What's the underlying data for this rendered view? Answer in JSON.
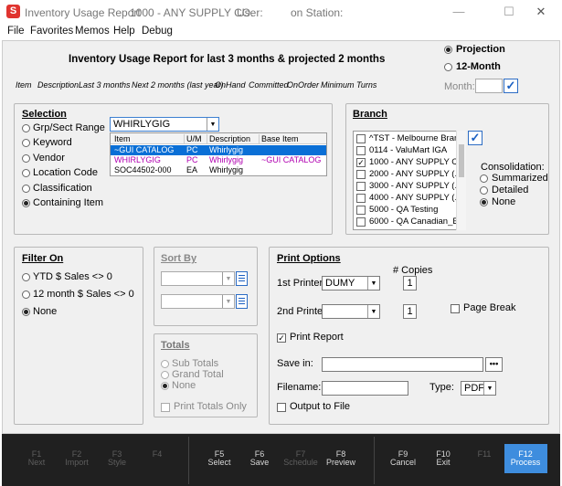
{
  "window": {
    "title": "Inventory Usage Report",
    "company": "1000 - ANY SUPPLY CO.",
    "user_label": "User:",
    "station_label": "on Station:"
  },
  "menu": [
    "File",
    "Favorites",
    "Memos",
    "Help",
    "Debug"
  ],
  "report_title": "Inventory Usage Report for last 3 months & projected 2 months",
  "columns": [
    "Item",
    "Description",
    "Last 3 months",
    "Next 2 months (last year)",
    "OnHand",
    "Committed",
    "OnOrder",
    "Minimum",
    "Turns"
  ],
  "mode": {
    "projection": "Projection",
    "twelve_month": "12-Month",
    "month_label": "Month:"
  },
  "selection": {
    "title": "Selection",
    "options": [
      "Grp/Sect Range",
      "Keyword",
      "Vendor",
      "Location Code",
      "Classification",
      "Containing Item"
    ],
    "value": "WHIRLYGIG",
    "grid": {
      "headers": [
        "Item",
        "U/M",
        "Description",
        "Base Item"
      ],
      "rows": [
        [
          "~GUI CATALOG",
          "PC",
          "Whirlygig",
          ""
        ],
        [
          "WHIRLYGIG",
          "PC",
          "Whirlygig",
          "~GUI CATALOG"
        ],
        [
          "SOC44502-000",
          "EA",
          "Whirlygig",
          ""
        ]
      ]
    }
  },
  "branch": {
    "title": "Branch",
    "items": [
      "^TST - Melbourne Bran...",
      "0114 - ValuMart IGA",
      "1000 - ANY SUPPLY CO.",
      "2000 - ANY SUPPLY (...",
      "3000 - ANY SUPPLY (...",
      "4000 - ANY SUPPLY (...",
      "5000 - QA Testing",
      "6000 - QA Canadian_Br..."
    ],
    "consolidation_label": "Consolidation:",
    "consolidation": [
      "Summarized",
      "Detailed",
      "None"
    ]
  },
  "filter": {
    "title": "Filter On",
    "options": [
      "YTD $ Sales <> 0",
      "12 month $ Sales <> 0",
      "None"
    ]
  },
  "sort": {
    "title": "Sort By"
  },
  "totals": {
    "title": "Totals",
    "options": [
      "Sub Totals",
      "Grand Total",
      "None"
    ],
    "print_only": "Print Totals Only"
  },
  "print": {
    "title": "Print Options",
    "printer1_label": "1st Printer:",
    "printer1": "DUMY",
    "printer2_label": "2nd Printer:",
    "copies_label": "# Copies",
    "copies1": "1",
    "copies2": "1",
    "page_break": "Page Break",
    "print_report": "Print Report",
    "save_in": "Save in:",
    "filename": "Filename:",
    "type_label": "Type:",
    "type": "PDF",
    "output_file": "Output to File",
    "more": "•••"
  },
  "fkeys": [
    {
      "k": "F1",
      "l": "Next"
    },
    {
      "k": "F2",
      "l": "Import"
    },
    {
      "k": "F3",
      "l": "Style"
    },
    {
      "k": "F4",
      "l": ""
    },
    {
      "k": "F5",
      "l": "Select"
    },
    {
      "k": "F6",
      "l": "Save"
    },
    {
      "k": "F7",
      "l": "Schedule"
    },
    {
      "k": "F8",
      "l": "Preview"
    },
    {
      "k": "F9",
      "l": "Cancel"
    },
    {
      "k": "F10",
      "l": "Exit"
    },
    {
      "k": "F11",
      "l": ""
    },
    {
      "k": "F12",
      "l": "Process"
    }
  ],
  "colors": {
    "accent": "#3e8dde",
    "highlight": "#0a6fd6",
    "purple": "#b000b0",
    "icon": "#e0342f"
  }
}
